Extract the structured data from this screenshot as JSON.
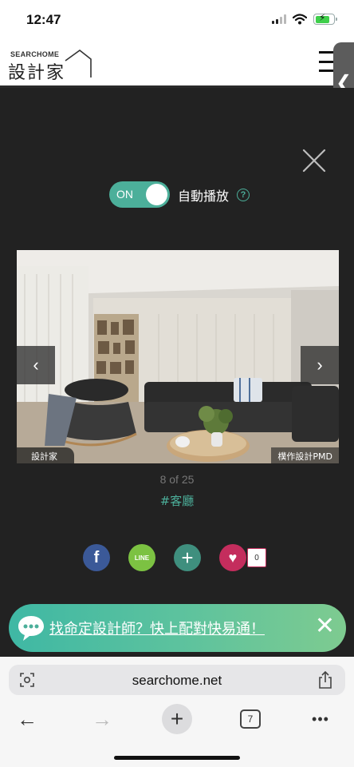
{
  "status_bar": {
    "time": "12:47"
  },
  "header": {
    "logo_top": "SEARCHOME",
    "logo_main": "設計家"
  },
  "viewer": {
    "autoplay_toggle": "ON",
    "autoplay_label": "自動播放",
    "help_glyph": "?",
    "counter": "8 of 25",
    "tag": "#客廳",
    "watermark": "設計家",
    "credit": "樸作設計PMD"
  },
  "share": {
    "facebook": "f",
    "line": "LINE",
    "like_count": "0"
  },
  "promo": {
    "text": "找命定設計師？快上配對快易通！"
  },
  "browser": {
    "url": "searchome.net",
    "tab_count": "7"
  },
  "colors": {
    "accent": "#4caf9a",
    "viewer_bg": "#222222",
    "facebook": "#3b5998",
    "line": "#7cc242",
    "like": "#c42d5d"
  },
  "icons": [
    "signal-icon",
    "wifi-icon",
    "battery-icon",
    "hamburger-icon",
    "chevron-left-icon",
    "close-icon",
    "help-icon",
    "chevron-right-icon",
    "facebook-icon",
    "line-icon",
    "plus-icon",
    "heart-icon",
    "chat-bubble-icon",
    "reader-icon",
    "share-icon",
    "back-arrow-icon",
    "forward-arrow-icon",
    "tabs-icon",
    "more-icon"
  ]
}
